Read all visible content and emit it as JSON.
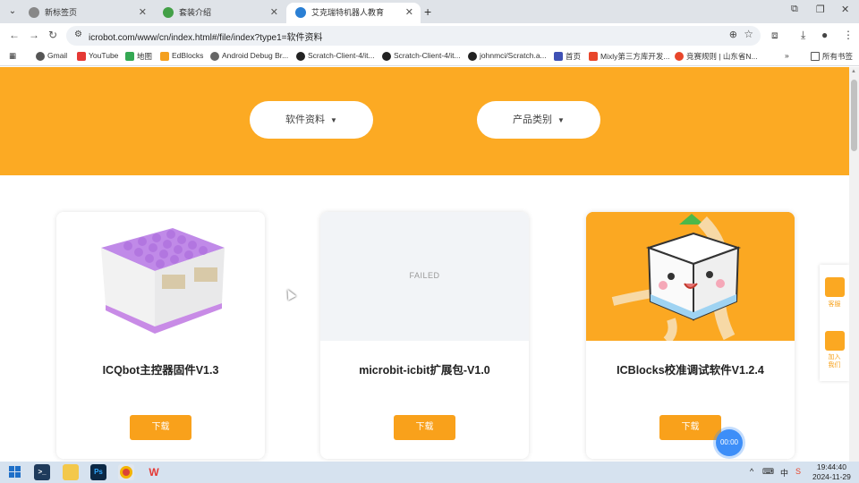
{
  "tabs": [
    {
      "title": "新标签页",
      "active": false
    },
    {
      "title": "套装介绍",
      "active": false
    },
    {
      "title": "艾克瑞特机器人教育",
      "active": true
    }
  ],
  "toolbar": {
    "url": "icrobot.com/www/cn/index.html#/file/index?type1=软件资料"
  },
  "bookmarks": [
    {
      "label": "Gmail",
      "icon": "google-icon"
    },
    {
      "label": "YouTube",
      "icon": "youtube-icon"
    },
    {
      "label": "地图",
      "icon": "maps-icon"
    },
    {
      "label": "EdBlocks",
      "icon": "edblocks-icon"
    },
    {
      "label": "Android Debug Br...",
      "icon": "globe-icon"
    },
    {
      "label": "Scratch-Client-4/it...",
      "icon": "github-icon"
    },
    {
      "label": "Scratch-Client-4/it...",
      "icon": "github-icon"
    },
    {
      "label": "johnmci/Scratch.a...",
      "icon": "github-icon"
    },
    {
      "label": "首页",
      "icon": "home-icon"
    },
    {
      "label": "Mixly第三方库开发...",
      "icon": "csdn-icon"
    },
    {
      "label": "竞赛规则 | 山东省N...",
      "icon": "site-icon"
    }
  ],
  "all_bookmarks": "所有书签",
  "filters": {
    "software": "软件资料",
    "category": "产品类别"
  },
  "cards": [
    {
      "title": "ICQbot主控器固件V1.3",
      "download": "下载",
      "image": "icqbot-controller"
    },
    {
      "title": "microbit-icbit扩展包-V1.0",
      "download": "下载",
      "image_status": "FAILED"
    },
    {
      "title": "ICBlocks校准调试软件V1.2.4",
      "download": "下载",
      "image": "icblocks-mascot"
    }
  ],
  "side_panel": {
    "item1": "客服",
    "item2": "加入我们"
  },
  "timer": "00:00",
  "taskbar": {
    "ime": "中",
    "time": "19:44:40",
    "date": "2024-11-29"
  },
  "colors": {
    "brand_orange": "#fcaa23",
    "button_orange": "#f9a11b"
  }
}
